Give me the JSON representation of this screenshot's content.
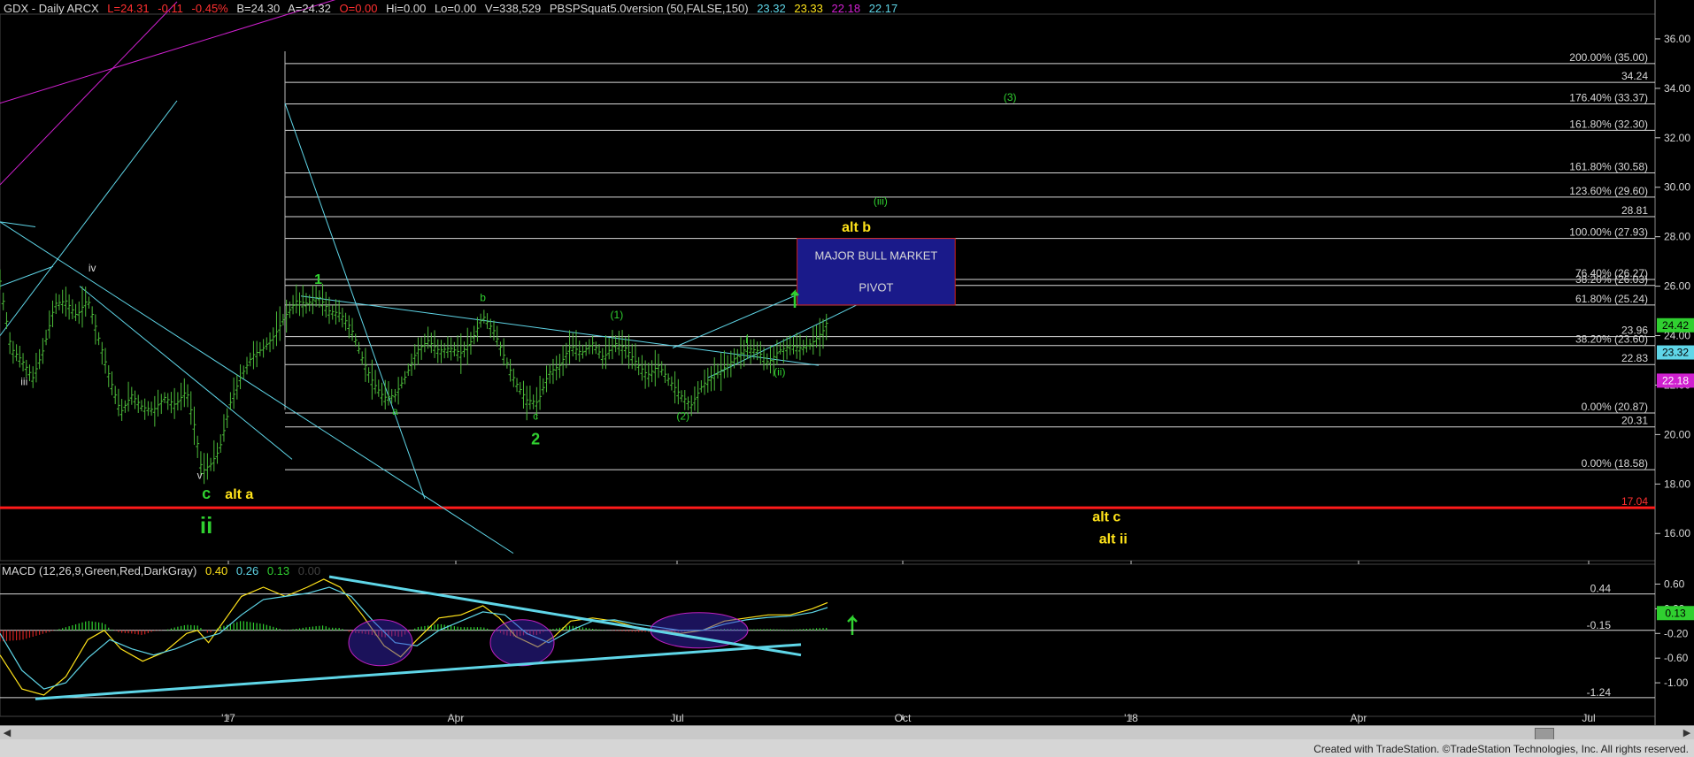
{
  "header": {
    "symbol": "GDX - Daily  ARCX",
    "last": "L=24.31",
    "change": "-0.11",
    "change_pct": "-0.45%",
    "bid": "B=24.30",
    "ask": "A=24.32",
    "open": "O=0.00",
    "hi": "Hi=0.00",
    "lo": "Lo=0.00",
    "volume": "V=338,529",
    "indicator": "PBSPSquat5.0version (50,FALSE,150)",
    "ind_v1": "23.32",
    "ind_v2": "23.33",
    "ind_v3": "22.18",
    "ind_v4": "22.17"
  },
  "macd_header": {
    "label": "MACD (12,26,9,Green,Red,DarkGray)",
    "v1": "0.40",
    "v2": "0.26",
    "v3": "0.13",
    "v4": "0.00"
  },
  "footer": "Created with TradeStation. ©TradeStation Technologies, Inc. All rights reserved.",
  "colors": {
    "bars": "#4cbc3a",
    "fib": "#d8d8d8",
    "trend": "#5fd6e8",
    "red_line": "#ff1a1a",
    "yellow": "#ffe31a",
    "green_lbl": "#30d030",
    "pivot_box": "#1a1a8a",
    "pivot_border": "#cc2020"
  },
  "chart_data": [
    {
      "type": "candlestick",
      "title": "",
      "x_ticks": [
        "'17",
        "Apr",
        "Jul",
        "Oct",
        "'18",
        "Apr",
        "Jul"
      ],
      "y_ticks": [
        "36.00",
        "34.00",
        "32.00",
        "30.00",
        "28.00",
        "26.00",
        "24.00",
        "22.00",
        "20.00",
        "18.00",
        "16.00"
      ],
      "ylim": [
        14.9,
        37.0
      ],
      "price_path": [
        [
          0,
          26.2
        ],
        [
          10,
          23.5
        ],
        [
          20,
          23.0
        ],
        [
          30,
          22.3
        ],
        [
          40,
          23.5
        ],
        [
          50,
          25.3
        ],
        [
          60,
          25.4
        ],
        [
          70,
          24.8
        ],
        [
          80,
          25.5
        ],
        [
          90,
          23.9
        ],
        [
          100,
          22.3
        ],
        [
          110,
          20.9
        ],
        [
          120,
          21.6
        ],
        [
          130,
          21.1
        ],
        [
          140,
          21.0
        ],
        [
          150,
          21.5
        ],
        [
          160,
          21.2
        ],
        [
          170,
          21.8
        ],
        [
          178,
          20.2
        ],
        [
          184,
          18.5
        ],
        [
          192,
          18.8
        ],
        [
          200,
          19.4
        ],
        [
          210,
          21.3
        ],
        [
          220,
          22.4
        ],
        [
          230,
          23.2
        ],
        [
          240,
          23.5
        ],
        [
          250,
          24.0
        ],
        [
          260,
          24.8
        ],
        [
          270,
          25.4
        ],
        [
          280,
          25.3
        ],
        [
          290,
          25.6
        ],
        [
          300,
          25.0
        ],
        [
          310,
          24.9
        ],
        [
          320,
          24.3
        ],
        [
          330,
          23.1
        ],
        [
          340,
          22.1
        ],
        [
          350,
          21.5
        ],
        [
          360,
          21.6
        ],
        [
          370,
          22.4
        ],
        [
          380,
          23.4
        ],
        [
          390,
          23.8
        ],
        [
          400,
          23.4
        ],
        [
          410,
          23.5
        ],
        [
          420,
          23.3
        ],
        [
          430,
          23.8
        ],
        [
          440,
          24.8
        ],
        [
          450,
          24.2
        ],
        [
          460,
          23.1
        ],
        [
          470,
          22.1
        ],
        [
          480,
          21.4
        ],
        [
          490,
          21.3
        ],
        [
          500,
          22.5
        ],
        [
          510,
          22.8
        ],
        [
          520,
          23.6
        ],
        [
          530,
          23.3
        ],
        [
          540,
          23.7
        ],
        [
          550,
          23.1
        ],
        [
          560,
          23.7
        ],
        [
          570,
          23.5
        ],
        [
          580,
          22.9
        ],
        [
          590,
          22.4
        ],
        [
          600,
          22.8
        ],
        [
          610,
          22.2
        ],
        [
          620,
          21.6
        ],
        [
          630,
          21.2
        ],
        [
          640,
          22.0
        ],
        [
          650,
          22.4
        ],
        [
          660,
          22.7
        ],
        [
          670,
          23.1
        ],
        [
          680,
          23.5
        ],
        [
          690,
          23.4
        ],
        [
          700,
          22.9
        ],
        [
          710,
          23.4
        ],
        [
          720,
          23.6
        ],
        [
          730,
          23.5
        ],
        [
          740,
          23.7
        ],
        [
          750,
          24.2
        ],
        [
          754,
          24.6
        ]
      ],
      "horizontal_levels": [
        {
          "label": "200.00% (35.00)",
          "value": 35.0
        },
        {
          "label": "34.24",
          "value": 34.24
        },
        {
          "label": "176.40% (33.37)",
          "value": 33.37
        },
        {
          "label": "161.80% (32.30)",
          "value": 32.3
        },
        {
          "label": "161.80% (30.58)",
          "value": 30.58
        },
        {
          "label": "123.60% (29.60)",
          "value": 29.6
        },
        {
          "label": "28.81",
          "value": 28.81
        },
        {
          "label": "100.00% (27.93)",
          "value": 27.93
        },
        {
          "label": "76.40% (26.27)",
          "value": 26.27
        },
        {
          "label": "38.20% (26.03)",
          "value": 26.03
        },
        {
          "label": "61.80% (25.24)",
          "value": 25.24
        },
        {
          "label": "23.96",
          "value": 23.96
        },
        {
          "label": "38.20% (23.60)",
          "value": 23.6
        },
        {
          "label": "22.83",
          "value": 22.83
        },
        {
          "label": "0.00% (20.87)",
          "value": 20.87
        },
        {
          "label": "20.31",
          "value": 20.31
        },
        {
          "label": "0.00% (18.58)",
          "value": 18.58
        },
        {
          "label": "17.04",
          "value": 17.04
        }
      ],
      "axis_badges": [
        {
          "label": "24.42",
          "value": 24.42,
          "color": "#30d030"
        },
        {
          "label": "23.32",
          "value": 23.32,
          "color": "#5fd6e8"
        },
        {
          "label": "22.18",
          "value": 22.18,
          "color": "#d020d0"
        }
      ],
      "wave_labels": [
        {
          "text": "iii",
          "x": 22,
          "y": 22.0,
          "color": "#d8d8d8",
          "size": 12
        },
        {
          "text": "iv",
          "x": 84,
          "y": 26.6,
          "color": "#d8d8d8",
          "size": 12
        },
        {
          "text": "v",
          "x": 182,
          "y": 18.2,
          "color": "#d8d8d8",
          "size": 12
        },
        {
          "text": "c",
          "x": 188,
          "y": 17.4,
          "color": "#30d030",
          "size": 18
        },
        {
          "text": "ii",
          "x": 188,
          "y": 16.0,
          "color": "#30d030",
          "size": 26
        },
        {
          "text": "alt a",
          "x": 218,
          "y": 17.4,
          "color": "#ffe31a",
          "size": 16
        },
        {
          "text": "1",
          "x": 290,
          "y": 26.1,
          "color": "#30d030",
          "size": 16
        },
        {
          "text": "a",
          "x": 360,
          "y": 20.8,
          "color": "#30d030",
          "size": 12
        },
        {
          "text": "b",
          "x": 440,
          "y": 25.4,
          "color": "#30d030",
          "size": 12
        },
        {
          "text": "c",
          "x": 488,
          "y": 20.6,
          "color": "#30d030",
          "size": 12
        },
        {
          "text": "2",
          "x": 488,
          "y": 19.6,
          "color": "#30d030",
          "size": 18
        },
        {
          "text": "(1)",
          "x": 562,
          "y": 24.7,
          "color": "#30d030",
          "size": 12
        },
        {
          "text": "(2)",
          "x": 632,
          "y": 20.6,
          "color": "#30d030",
          "size": 12
        },
        {
          "text": "i",
          "x": 690,
          "y": 23.7,
          "color": "#30d030",
          "size": 12
        },
        {
          "text": "(ii)",
          "x": 720,
          "y": 22.4,
          "color": "#30d030",
          "size": 12
        },
        {
          "text": "(iii)",
          "x": 812,
          "y": 29.3,
          "color": "#30d030",
          "size": 12
        },
        {
          "text": "(3)",
          "x": 930,
          "y": 33.5,
          "color": "#30d030",
          "size": 12
        },
        {
          "text": "alt b",
          "x": 790,
          "y": 28.2,
          "color": "#ffe31a",
          "size": 16
        },
        {
          "text": "alt c",
          "x": 1018,
          "y": 16.5,
          "color": "#ffe31a",
          "size": 16
        },
        {
          "text": "alt ii",
          "x": 1024,
          "y": 15.6,
          "color": "#ffe31a",
          "size": 16
        }
      ],
      "pivot_box": {
        "line1": "MAJOR BULL MARKET",
        "line2": "PIVOT",
        "x0": 736,
        "x1": 880,
        "y0": 25.24,
        "y1": 27.93
      }
    },
    {
      "type": "macd",
      "title": "MACD (12,26,9,Green,Red,DarkGray)",
      "y_ticks": [
        "0.60",
        "0.20",
        "-0.20",
        "-0.60",
        "-1.00"
      ],
      "ylim": [
        -1.4,
        0.75
      ],
      "levels": [
        {
          "label": "0.44",
          "value": 0.44
        },
        {
          "label": "-0.15",
          "value": -0.15
        },
        {
          "label": "-1.24",
          "value": -1.24
        }
      ],
      "axis_badges": [
        {
          "label": "0.13",
          "value": 0.13,
          "color": "#30d030"
        }
      ],
      "macd_path": [
        [
          0,
          -0.55
        ],
        [
          20,
          -1.1
        ],
        [
          40,
          -1.2
        ],
        [
          60,
          -0.9
        ],
        [
          80,
          -0.3
        ],
        [
          95,
          -0.15
        ],
        [
          110,
          -0.45
        ],
        [
          130,
          -0.65
        ],
        [
          150,
          -0.5
        ],
        [
          170,
          -0.2
        ],
        [
          180,
          -0.15
        ],
        [
          190,
          -0.35
        ],
        [
          200,
          -0.1
        ],
        [
          220,
          0.4
        ],
        [
          240,
          0.55
        ],
        [
          260,
          0.4
        ],
        [
          280,
          0.55
        ],
        [
          295,
          0.68
        ],
        [
          310,
          0.55
        ],
        [
          330,
          0.1
        ],
        [
          350,
          -0.4
        ],
        [
          365,
          -0.58
        ],
        [
          380,
          -0.3
        ],
        [
          400,
          0.05
        ],
        [
          420,
          0.1
        ],
        [
          440,
          0.25
        ],
        [
          455,
          0.05
        ],
        [
          470,
          -0.25
        ],
        [
          490,
          -0.42
        ],
        [
          505,
          -0.25
        ],
        [
          520,
          0.0
        ],
        [
          540,
          0.05
        ],
        [
          560,
          0.0
        ],
        [
          580,
          -0.1
        ],
        [
          600,
          -0.15
        ],
        [
          620,
          -0.2
        ],
        [
          640,
          -0.15
        ],
        [
          660,
          0.0
        ],
        [
          680,
          0.05
        ],
        [
          700,
          0.1
        ],
        [
          720,
          0.1
        ],
        [
          740,
          0.2
        ],
        [
          754,
          0.3
        ]
      ],
      "signal_path": [
        [
          0,
          -0.2
        ],
        [
          20,
          -0.8
        ],
        [
          40,
          -1.1
        ],
        [
          60,
          -1.0
        ],
        [
          80,
          -0.6
        ],
        [
          100,
          -0.3
        ],
        [
          120,
          -0.45
        ],
        [
          140,
          -0.55
        ],
        [
          160,
          -0.45
        ],
        [
          180,
          -0.3
        ],
        [
          200,
          -0.2
        ],
        [
          220,
          0.1
        ],
        [
          240,
          0.35
        ],
        [
          260,
          0.4
        ],
        [
          280,
          0.45
        ],
        [
          300,
          0.55
        ],
        [
          320,
          0.4
        ],
        [
          340,
          0.0
        ],
        [
          360,
          -0.35
        ],
        [
          380,
          -0.4
        ],
        [
          400,
          -0.15
        ],
        [
          420,
          0.0
        ],
        [
          440,
          0.15
        ],
        [
          460,
          0.1
        ],
        [
          480,
          -0.2
        ],
        [
          500,
          -0.35
        ],
        [
          520,
          -0.15
        ],
        [
          540,
          0.0
        ],
        [
          560,
          0.02
        ],
        [
          580,
          -0.05
        ],
        [
          600,
          -0.1
        ],
        [
          620,
          -0.15
        ],
        [
          640,
          -0.15
        ],
        [
          660,
          -0.05
        ],
        [
          680,
          0.02
        ],
        [
          700,
          0.06
        ],
        [
          720,
          0.08
        ],
        [
          740,
          0.14
        ],
        [
          754,
          0.22
        ]
      ]
    }
  ]
}
